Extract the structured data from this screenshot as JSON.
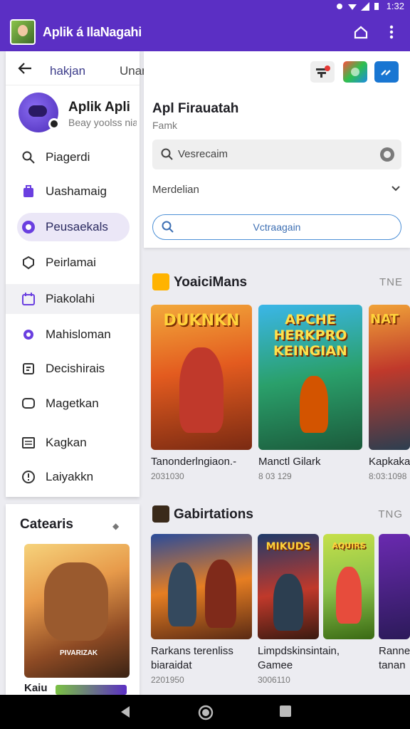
{
  "status": {
    "time": "1:32"
  },
  "app": {
    "title": "Aplik á IlaNagahi"
  },
  "drawer": {
    "tabs": [
      "hakjan",
      "Unamnayn"
    ],
    "profile": {
      "name": "Aplik Apli",
      "subtitle": "Beay yoolss nia"
    },
    "items": [
      {
        "label": "Piagerdi",
        "icon": "search-icon"
      },
      {
        "label": "Uashamaig",
        "icon": "bag-icon"
      },
      {
        "label": "Peusaekals",
        "icon": "circle-badge-icon",
        "active": true
      },
      {
        "label": "Peirlamai",
        "icon": "shield-icon"
      },
      {
        "label": "Piakolahi",
        "icon": "calendar-icon",
        "highlighted": true
      },
      {
        "label": "Mahisloman",
        "icon": "gear-icon"
      },
      {
        "label": "Decishirais",
        "icon": "document-icon"
      },
      {
        "label": "Magetkan",
        "icon": "chat-bubble-icon"
      },
      {
        "label": "Kagkan",
        "icon": "list-icon"
      },
      {
        "label": "Laiyakkn",
        "icon": "info-icon"
      }
    ]
  },
  "categories": {
    "title": "Catearis",
    "card_caption": "PIVARIZAK",
    "card_label": "Kaiu"
  },
  "panel": {
    "title": "Apl Firauatah",
    "subtitle": "Famk",
    "search_value": "Vesrecaim",
    "select_value": "Merdelian",
    "outline_button": "Vctraagain"
  },
  "sections": [
    {
      "title": "YoaiciMans",
      "more": "TNE",
      "cards": [
        {
          "art_title": "DUKNKN",
          "name": "Tanonderlngiaon.-",
          "meta": "2031030"
        },
        {
          "art_title": "APCHE HERKPRO KEINGIAN",
          "name": "Manctl Gilark",
          "meta": "8 03 129"
        },
        {
          "art_title": "NAT",
          "name": "Kapkaka",
          "meta": "8:03:1098"
        }
      ]
    },
    {
      "title": "Gabirtations",
      "more": "TNG",
      "cards": [
        {
          "art_title": "",
          "name": "Rarkans terenliss",
          "name2": "biaraidat",
          "meta": "2201950"
        },
        {
          "art_title": "MIKUDS",
          "name": "Limpdskinsintain,",
          "name2": "Gamee",
          "meta": "3006110"
        },
        {
          "art_title": "AQUIRS",
          "name": "",
          "name2": "",
          "meta": ""
        },
        {
          "art_title": "",
          "name": "Ranne",
          "name2": "tanan",
          "meta": ""
        }
      ]
    }
  ],
  "colors": {
    "appbar": "#5b2fc4",
    "accent": "#6a3fe0",
    "outline_button": "#4c8fd6"
  }
}
